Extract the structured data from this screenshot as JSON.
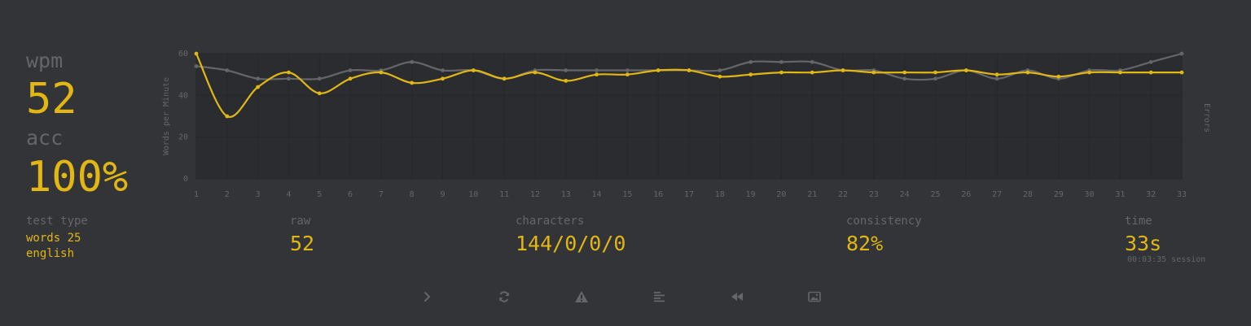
{
  "stats": {
    "wpm_label": "wpm",
    "wpm_value": "52",
    "acc_label": "acc",
    "acc_value": "100%"
  },
  "details": {
    "test_type_label": "test type",
    "test_type_mode": "words 25",
    "test_type_language": "english",
    "raw_label": "raw",
    "raw_value": "52",
    "characters_label": "characters",
    "characters_value": "144/0/0/0",
    "consistency_label": "consistency",
    "consistency_value": "82%",
    "time_label": "time",
    "time_value": "33s",
    "session_value": "00:03:35 session"
  },
  "actions": [
    {
      "name": "next-test",
      "icon": "chevron-right-icon"
    },
    {
      "name": "repeat-test",
      "icon": "refresh-icon"
    },
    {
      "name": "report-issue",
      "icon": "warning-icon"
    },
    {
      "name": "words-history",
      "icon": "align-left-icon"
    },
    {
      "name": "replay",
      "icon": "backward-icon"
    },
    {
      "name": "save-screenshot",
      "icon": "image-icon"
    }
  ],
  "colors": {
    "background": "#323437",
    "accent": "#e2b714",
    "sub": "#646669",
    "raw_line": "#646669",
    "plot_bg": "#2b2c2f"
  },
  "chart_data": {
    "type": "line",
    "ylabel": "Words per Minute",
    "y2label": "Errors",
    "ylim": [
      0,
      60
    ],
    "yticks": [
      0,
      20,
      40,
      60
    ],
    "grid": true,
    "x": [
      1,
      2,
      3,
      4,
      5,
      6,
      7,
      8,
      9,
      10,
      11,
      12,
      13,
      14,
      15,
      16,
      17,
      18,
      19,
      20,
      21,
      22,
      23,
      24,
      25,
      26,
      27,
      28,
      29,
      30,
      31,
      32,
      33
    ],
    "series": [
      {
        "name": "wpm",
        "color": "#e2b714",
        "values": [
          60,
          30,
          44,
          51,
          41,
          48,
          51,
          46,
          48,
          52,
          48,
          51,
          47,
          50,
          50,
          52,
          52,
          49,
          50,
          51,
          51,
          52,
          51,
          51,
          51,
          52,
          50,
          51,
          49,
          51,
          51,
          51,
          51
        ]
      },
      {
        "name": "raw",
        "color": "#646669",
        "values": [
          54,
          52,
          48,
          48,
          48,
          52,
          52,
          56,
          52,
          52,
          48,
          52,
          52,
          52,
          52,
          52,
          52,
          52,
          56,
          56,
          56,
          52,
          52,
          48,
          48,
          52,
          48,
          52,
          48,
          52,
          52,
          56,
          60
        ]
      }
    ]
  }
}
